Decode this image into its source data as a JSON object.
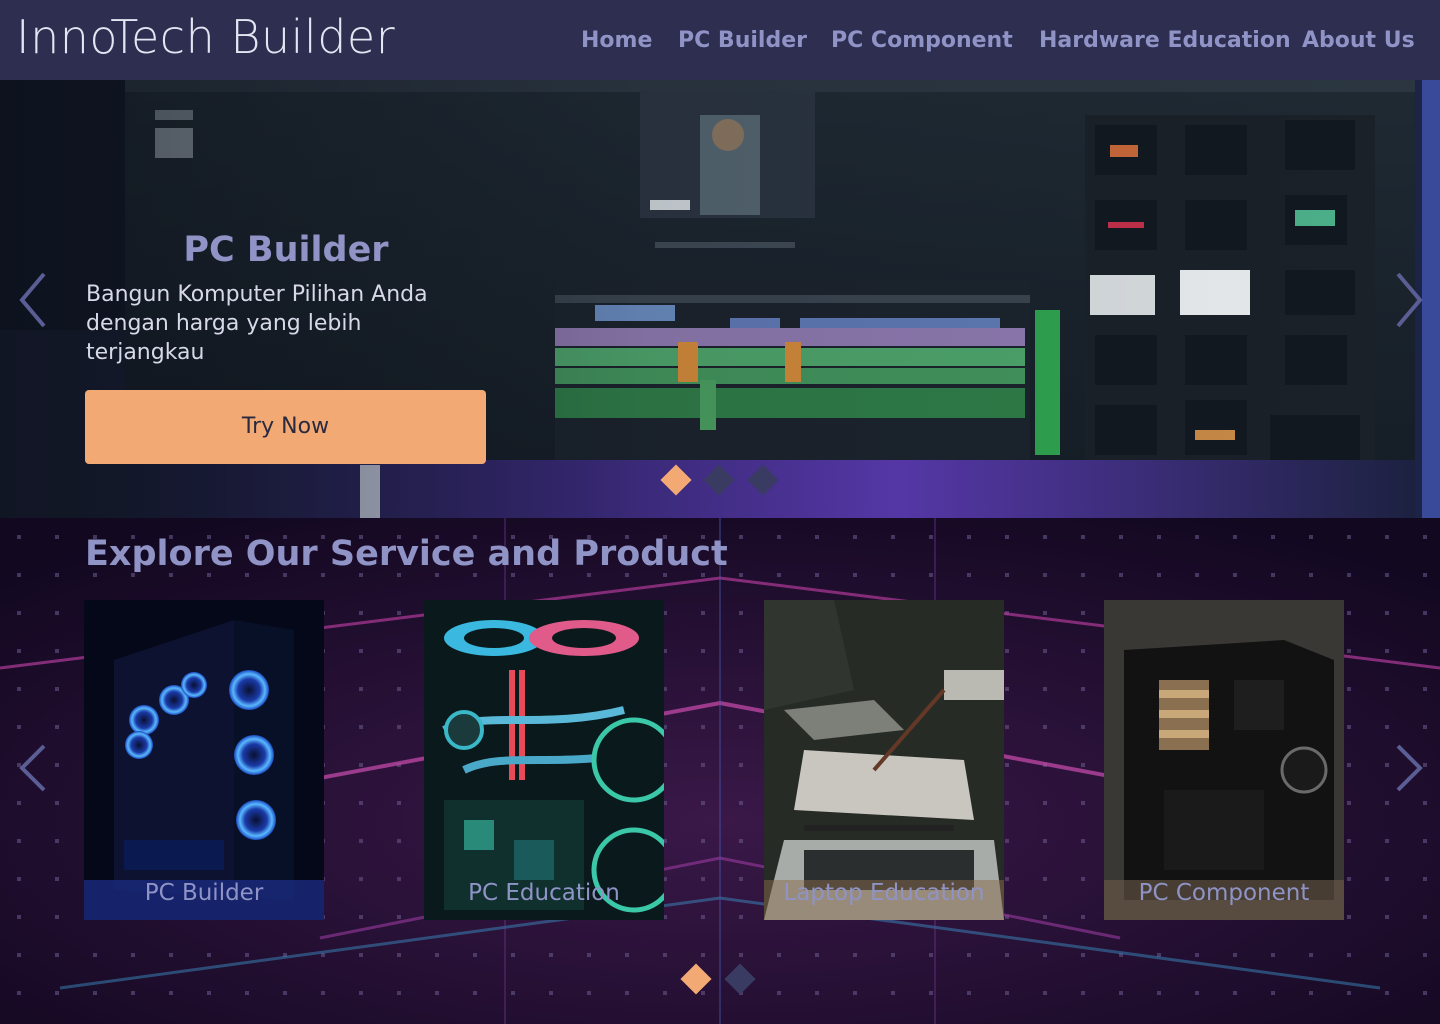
{
  "brand": "InnoTech Builder",
  "nav": [
    {
      "label": "Home"
    },
    {
      "label": "PC Builder"
    },
    {
      "label": "PC Component"
    },
    {
      "label": "Hardware Education"
    },
    {
      "label": "About Us"
    }
  ],
  "hero": {
    "title": "PC Builder",
    "subtitle": "Bangun Komputer Pilihan Anda dengan harga yang lebih terjangkau",
    "button_label": "Try Now",
    "slides": 3,
    "active_slide": 1
  },
  "explore": {
    "title": "Explore Our Service and Product",
    "cards": [
      {
        "label": "PC Builder"
      },
      {
        "label": "PC Education"
      },
      {
        "label": "Laptop Education"
      },
      {
        "label": "PC Component"
      }
    ],
    "pages": 2,
    "active_page": 1
  },
  "icons": {
    "prev": "chevron-left-icon",
    "next": "chevron-right-icon"
  },
  "colors": {
    "navbar": "#2d2e50",
    "accent": "#f2a974",
    "link": "#8f93c6",
    "dot_inactive": "#3a3b62"
  }
}
